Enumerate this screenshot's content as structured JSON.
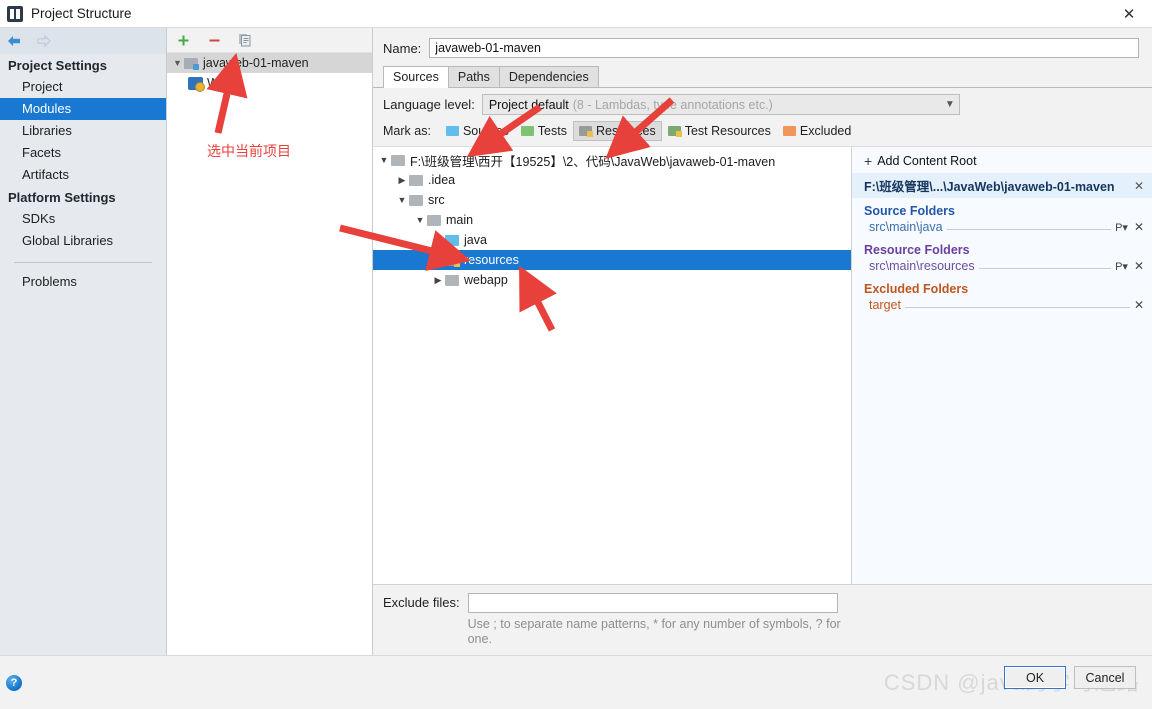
{
  "window": {
    "title": "Project Structure",
    "app_icon": "intellij-idea-icon",
    "close_icon": "close-icon"
  },
  "sidebar": {
    "nav": {
      "back_icon": "back-arrow-icon",
      "forward_icon": "forward-arrow-icon"
    },
    "groups": [
      {
        "label": "Project Settings",
        "items": [
          {
            "label": "Project",
            "selected": false
          },
          {
            "label": "Modules",
            "selected": true
          },
          {
            "label": "Libraries",
            "selected": false
          },
          {
            "label": "Facets",
            "selected": false
          },
          {
            "label": "Artifacts",
            "selected": false
          }
        ]
      },
      {
        "label": "Platform Settings",
        "items": [
          {
            "label": "SDKs",
            "selected": false
          },
          {
            "label": "Global Libraries",
            "selected": false
          }
        ]
      }
    ],
    "problems": {
      "label": "Problems"
    }
  },
  "modules_panel": {
    "toolbar": {
      "add_icon": "plus-icon",
      "remove_icon": "minus-icon",
      "copy_icon": "copy-icon"
    },
    "tree": [
      {
        "label": "javaweb-01-maven",
        "indent": 0,
        "expander": "v",
        "icon": "module-folder-icon",
        "selected": true
      },
      {
        "label": "Web",
        "indent": 1,
        "expander": "",
        "icon": "web-facet-icon",
        "selected": false
      }
    ]
  },
  "detail": {
    "name_label": "Name:",
    "name_value": "javaweb-01-maven",
    "tabs": [
      {
        "label": "Sources",
        "active": true
      },
      {
        "label": "Paths",
        "active": false
      },
      {
        "label": "Dependencies",
        "active": false
      }
    ],
    "language_level": {
      "label": "Language level:",
      "value": "Project default",
      "hint": "(8 - Lambdas, type annotations etc.)",
      "caret_icon": "chevron-down-icon"
    },
    "mark_as": {
      "label": "Mark as:",
      "buttons": [
        {
          "label": "Sources",
          "mnemonic": "S",
          "icon": "sources-folder-icon",
          "pressed": false
        },
        {
          "label": "Tests",
          "mnemonic": "T",
          "icon": "tests-folder-icon",
          "pressed": false
        },
        {
          "label": "Resources",
          "mnemonic": "R",
          "icon": "resources-folder-icon",
          "pressed": true
        },
        {
          "label": "Test Resources",
          "mnemonic": "",
          "icon": "test-resources-folder-icon",
          "pressed": false
        },
        {
          "label": "Excluded",
          "mnemonic": "E",
          "icon": "excluded-folder-icon",
          "pressed": false
        }
      ]
    },
    "source_tree": [
      {
        "label": "F:\\班级管理\\西开【19525】\\2、代码\\JavaWeb\\javaweb-01-maven",
        "indent": 0,
        "expander": "v",
        "icon": "folder-icon",
        "selected": false
      },
      {
        "label": ".idea",
        "indent": 1,
        "expander": ">",
        "icon": "folder-icon",
        "selected": false
      },
      {
        "label": "src",
        "indent": 1,
        "expander": "v",
        "icon": "folder-icon",
        "selected": false
      },
      {
        "label": "main",
        "indent": 2,
        "expander": "v",
        "icon": "folder-icon",
        "selected": false
      },
      {
        "label": "java",
        "indent": 3,
        "expander": "",
        "icon": "sources-folder-icon",
        "selected": false
      },
      {
        "label": "resources",
        "indent": 3,
        "expander": "",
        "icon": "resources-folder-icon",
        "selected": true
      },
      {
        "label": "webapp",
        "indent": 2,
        "expander": ">",
        "icon": "folder-icon",
        "selected": false
      }
    ],
    "roots_panel": {
      "add_content_root": "Add Content Root",
      "add_icon": "plus-icon",
      "root_path": "F:\\班级管理\\...\\JavaWeb\\javaweb-01-maven",
      "root_remove_icon": "close-icon",
      "sections": [
        {
          "title": "Source Folders",
          "kind": "src",
          "rows": [
            {
              "path": "src\\main\\java",
              "prop_icon": "properties-icon",
              "remove_icon": "close-icon"
            }
          ]
        },
        {
          "title": "Resource Folders",
          "kind": "res",
          "rows": [
            {
              "path": "src\\main\\resources",
              "prop_icon": "properties-icon",
              "remove_icon": "close-icon"
            }
          ]
        },
        {
          "title": "Excluded Folders",
          "kind": "excl",
          "rows": [
            {
              "path": "target",
              "prop_icon": "",
              "remove_icon": "close-icon"
            }
          ]
        }
      ]
    },
    "exclude_files": {
      "label": "Exclude files:",
      "value": "",
      "placeholder": "",
      "hint": "Use ; to separate name patterns, * for any number of symbols, ? for one."
    }
  },
  "footer": {
    "help_icon": "help-icon",
    "help_glyph": "?",
    "ok_label": "OK",
    "cancel_label": "Cancel",
    "watermark": "CSDN @java的学习之路"
  },
  "annotations": {
    "accent_color": "#e8413c",
    "notes": [
      {
        "text": "选中当前项目"
      }
    ]
  }
}
